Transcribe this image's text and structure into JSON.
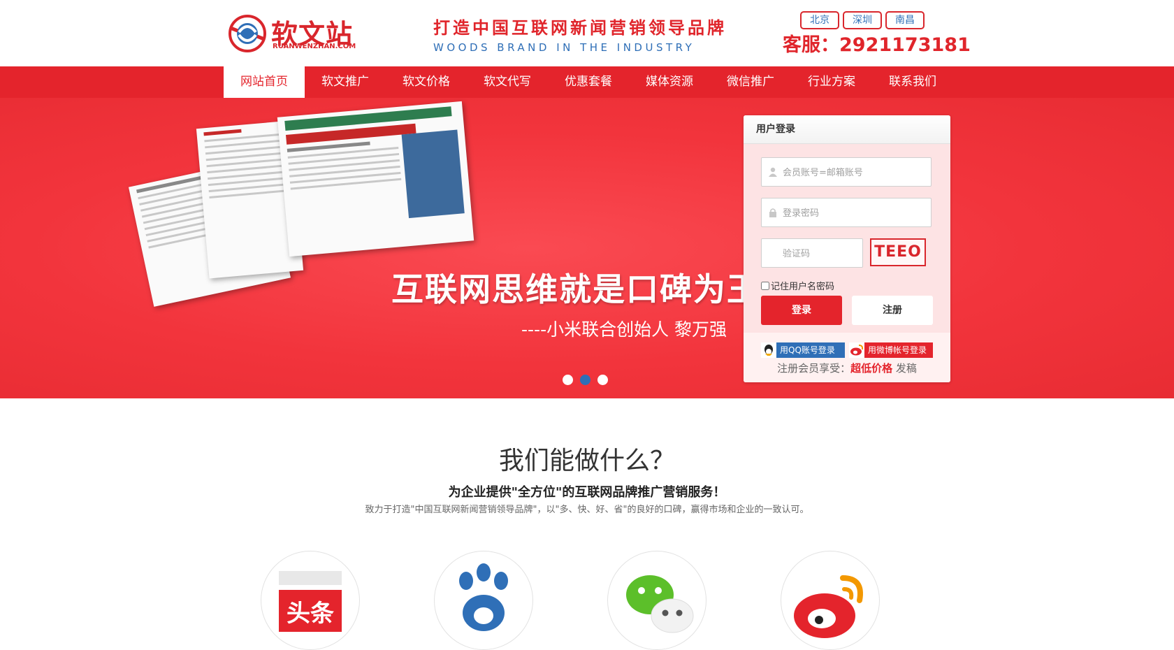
{
  "header": {
    "logo_text": "软文站",
    "logo_sub": "RUANWENZHAN.COM",
    "slogan_cn": "打造中国互联网新闻营销领导品牌",
    "slogan_en": "WOODS BRAND IN THE INDUSTRY",
    "cities": [
      "北京",
      "深圳",
      "南昌"
    ],
    "hotline": "客服：2921173181"
  },
  "nav": {
    "items": [
      "网站首页",
      "软文推广",
      "软文价格",
      "软文代写",
      "优惠套餐",
      "媒体资源",
      "微信推广",
      "行业方案",
      "联系我们"
    ],
    "active_index": 0
  },
  "banner": {
    "headline": "互联网思维就是口碑为王",
    "quote": "----小米联合创始人 黎万强",
    "slide_count": 3,
    "active_slide": 2
  },
  "login": {
    "title": "用户登录",
    "username_placeholder": "会员账号=邮箱账号",
    "password_placeholder": "登录密码",
    "captcha_placeholder": "验证码",
    "captcha_text": "TEEO",
    "remember_label": "记住用户名密码",
    "login_button": "登录",
    "register_button": "注册",
    "qq_login": "用QQ账号登录",
    "weibo_login": "用微博帐号登录",
    "promo_prefix": "注册会员享受：",
    "promo_highlight": "超低价格",
    "promo_suffix": " 发稿"
  },
  "services": {
    "title": "我们能做什么？",
    "subtitle": "为企业提供\"全方位\"的互联网品牌推广营销服务！",
    "description": "致力于打造\"中国互联网新闻营销领导品牌\"，以\"多、快、好、省\"的良好的口碑，赢得市场和企业的一致认可。",
    "items": [
      {
        "icon": "toutiao-icon",
        "label": "头条"
      },
      {
        "icon": "baidu-icon"
      },
      {
        "icon": "wechat-icon"
      },
      {
        "icon": "weibo-icon"
      }
    ]
  },
  "colors": {
    "brand_red": "#e4242c",
    "brand_blue": "#2f6fb7"
  }
}
